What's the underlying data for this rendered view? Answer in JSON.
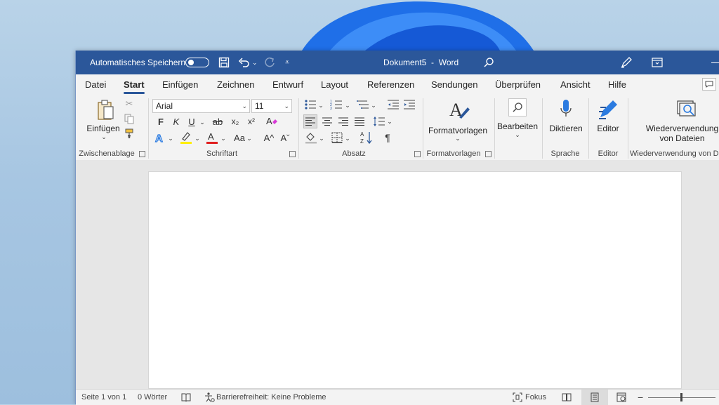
{
  "window": {
    "autosave_label": "Automatisches Speichern",
    "document_title": "Dokument5",
    "title_separator": "-",
    "app_name": "Word"
  },
  "tabs": [
    "Datei",
    "Start",
    "Einfügen",
    "Zeichnen",
    "Entwurf",
    "Layout",
    "Referenzen",
    "Sendungen",
    "Überprüfen",
    "Ansicht",
    "Hilfe"
  ],
  "active_tab": "Start",
  "ribbon": {
    "clipboard": {
      "paste_label": "Einfügen",
      "group_label": "Zwischenablage"
    },
    "font": {
      "font_name": "Arial",
      "font_size": "11",
      "bold": "F",
      "italic": "K",
      "underline": "U",
      "strike": "ab",
      "subscript": "x₂",
      "superscript": "x²",
      "change_case": "Aa",
      "grow": "A^",
      "shrink": "Aˇ",
      "group_label": "Schriftart"
    },
    "paragraph": {
      "group_label": "Absatz",
      "pilcrow": "¶"
    },
    "styles": {
      "label": "Formatvorlagen",
      "group_label": "Formatvorlagen"
    },
    "editing": {
      "label": "Bearbeiten"
    },
    "voice": {
      "label": "Diktieren",
      "group_label": "Sprache"
    },
    "editor": {
      "label": "Editor",
      "group_label": "Editor"
    },
    "reuse": {
      "label_line1": "Wiederverwendung",
      "label_line2": "von Dateien",
      "group_label": "Wiederverwendung von D"
    }
  },
  "statusbar": {
    "page": "Seite 1 von 1",
    "words": "0 Wörter",
    "accessibility": "Barrierefreiheit: Keine Probleme",
    "focus": "Fokus"
  },
  "colors": {
    "title_bar": "#2b579a",
    "accent": "#2b579a",
    "highlight_yellow": "#ffee00",
    "font_red": "#e02020"
  }
}
